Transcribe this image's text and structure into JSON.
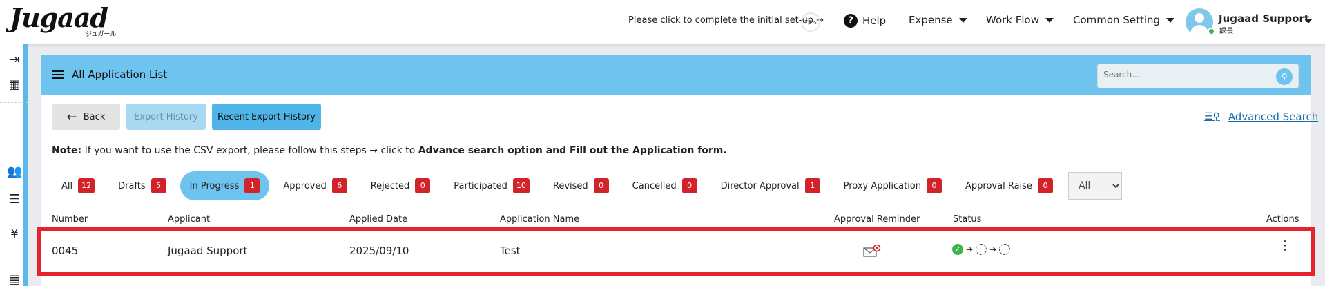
{
  "header": {
    "logo": "Jugaad",
    "logo_sub": "ジュガール",
    "setup_text": "Please click to complete the initial set-up →",
    "setup_progress": "75%",
    "help": "Help",
    "nav": [
      "Expense",
      "Work Flow",
      "Common Setting"
    ],
    "user_name": "Jugaad Support",
    "user_role": "課長"
  },
  "sidebar": {
    "icons": [
      "collapse-icon",
      "building-icon",
      "users-icon",
      "list-icon",
      "yen-icon",
      "document-icon"
    ]
  },
  "card": {
    "title": "All Application List",
    "search_placeholder": "Search...",
    "back": "Back",
    "export_history": "Export History",
    "recent_export_history": "Recent Export History",
    "advanced_search": "Advanced Search",
    "note_label": "Note:",
    "note_text": "If you want to use the CSV export, please follow this steps → click to",
    "note_bold": "Advance search option and Fill out the Application form."
  },
  "tabs": [
    {
      "label": "All",
      "count": "12"
    },
    {
      "label": "Drafts",
      "count": "5"
    },
    {
      "label": "In Progress",
      "count": "1"
    },
    {
      "label": "Approved",
      "count": "6"
    },
    {
      "label": "Rejected",
      "count": "0"
    },
    {
      "label": "Participated",
      "count": "10"
    },
    {
      "label": "Revised",
      "count": "0"
    },
    {
      "label": "Cancelled",
      "count": "0"
    },
    {
      "label": "Director Approval",
      "count": "1"
    },
    {
      "label": "Proxy Application",
      "count": "0"
    },
    {
      "label": "Approval Raise",
      "count": "0"
    }
  ],
  "active_tab": "In Progress",
  "filter_select": "All",
  "table": {
    "columns": [
      "Number",
      "Applicant",
      "Applied Date",
      "Application Name",
      "Approval Reminder",
      "Status",
      "Actions"
    ],
    "rows": [
      {
        "number": "0045",
        "applicant": "Jugaad Support",
        "applied_date": "2025/09/10",
        "application_name": "Test"
      }
    ]
  },
  "colors": {
    "accent": "#6ec4ef",
    "badge": "#d2232a",
    "highlight": "#e5252d",
    "status_ok": "#3bb54a"
  }
}
